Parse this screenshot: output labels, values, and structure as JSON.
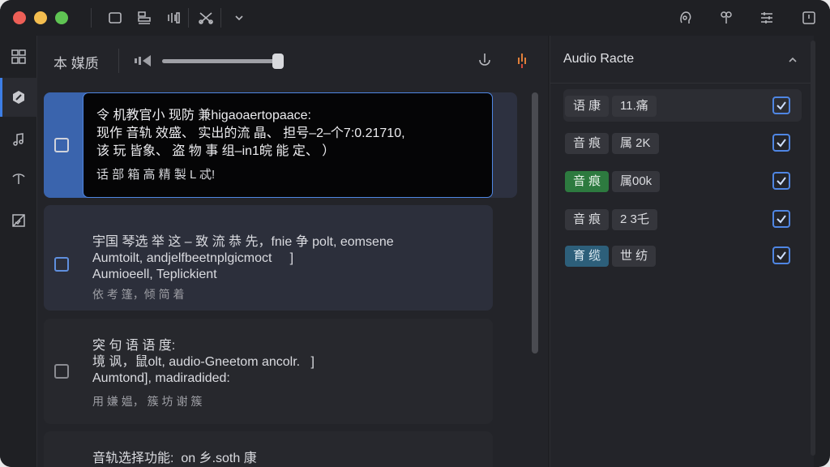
{
  "toolbar": {
    "icons": [
      "window-icon",
      "stack-icon",
      "bars-icon",
      "scissors-icon",
      "chevron-down-icon",
      "face-icon",
      "pin-icon",
      "sliders-icon",
      "export-icon"
    ]
  },
  "sidebar": {
    "items": [
      "grid-icon",
      "pen-icon",
      "music-icon",
      "antenna-icon",
      "image-icon"
    ],
    "active_index": 1
  },
  "middle": {
    "title": "本 媒质",
    "volume_level": 0.98,
    "cards": [
      {
        "text": "令 机教官小 现防 兼higaoaertopaace:\n现作 音轨 效盛、 实出的流 晶、 担号–2–个7:0.21710,\n该 玩 皆象、 盗 物 事 组–in1皖 能 定、 ）",
        "meta": "话 部 箱 高 精 製 L 忒!"
      },
      {
        "text": "宇国 琴选 举 这 – 致 流 恭 先，fnie 争 polt, eomsene\nAumtoilt, andjelfbeetnplgicmoct     ]\nAumioeell, Teplickient",
        "meta": "依 考 篷，倾 简 着"
      },
      {
        "text": "突 句 语 语 度:\n境 讽，鼠olt, audio-Gneetom ancolr.   ]\nAumtond], madiradided:",
        "meta": "用 嫌 媪， 簇 坊 谢 簇"
      },
      {
        "text": "音轨选择功能:  on 乡.soth 康",
        "meta": ""
      }
    ]
  },
  "right": {
    "title": "Audio Racte",
    "rows": [
      {
        "lang": "语 康",
        "value": "11.痛",
        "style": "default",
        "checked": true
      },
      {
        "lang": "音 痕",
        "value": "属 2K",
        "style": "default",
        "checked": true
      },
      {
        "lang": "音 痕",
        "value": "属00k",
        "style": "green",
        "checked": true
      },
      {
        "lang": "音 痕",
        "value": "2 3乇",
        "style": "default",
        "checked": true
      },
      {
        "lang": "育 缆",
        "value": "世 纺",
        "style": "teal",
        "checked": true
      }
    ]
  },
  "colors": {
    "accent": "#3d7ee6",
    "window_bg": "#1f2024",
    "panel_bg": "#232429",
    "green_pill": "#2d7a3f",
    "teal_pill": "#2d5f7a"
  }
}
